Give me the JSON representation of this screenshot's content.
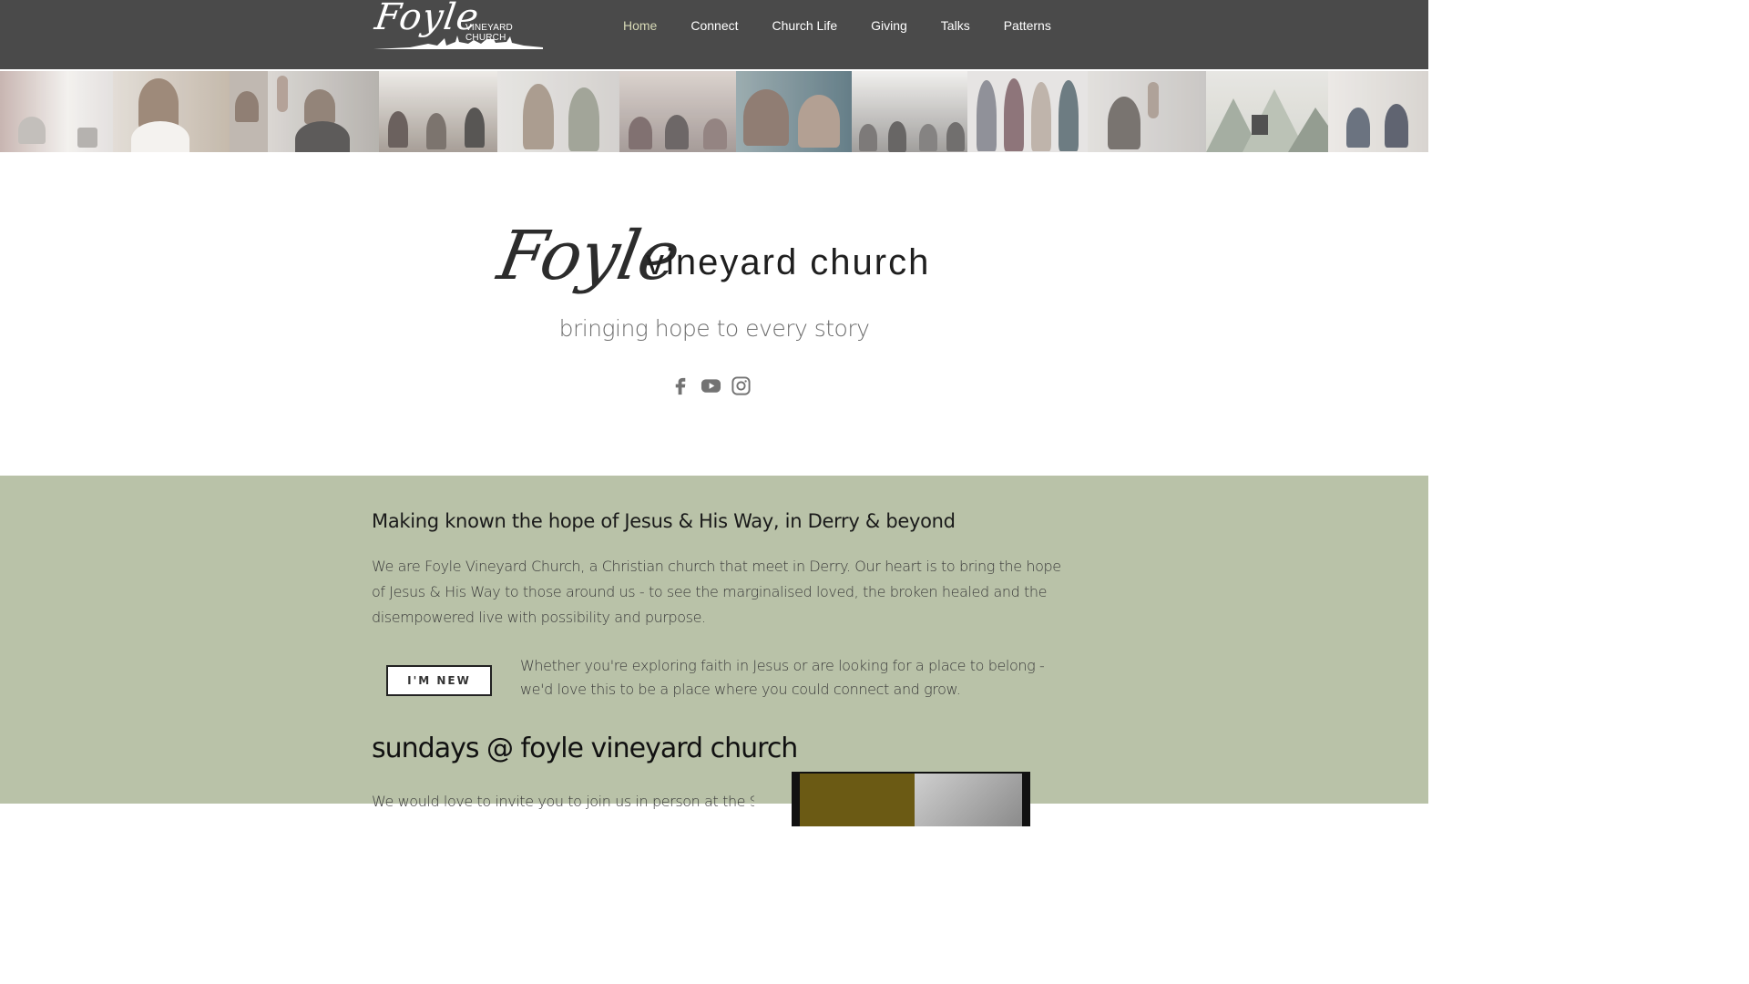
{
  "header": {
    "logo_script": "Foyle",
    "logo_subtitle": "VINEYARD CHURCH",
    "nav": [
      {
        "label": "Home",
        "active": true
      },
      {
        "label": "Connect",
        "active": false
      },
      {
        "label": "Church Life",
        "active": false
      },
      {
        "label": "Giving",
        "active": false
      },
      {
        "label": "Talks",
        "active": false
      },
      {
        "label": "Patterns",
        "active": false
      }
    ]
  },
  "hero": {
    "script": "Foyle",
    "words": "vineyard church",
    "tagline": "bringing hope to every story",
    "social": [
      "facebook-icon",
      "youtube-icon",
      "instagram-icon"
    ]
  },
  "main": {
    "mission_heading": "Making known the hope of Jesus & His Way, in Derry & beyond",
    "intro": "We are Foyle Vineyard Church, a Christian church that meet in Derry. Our heart is to bring the hope of Jesus & His Way to those around us - to see the marginalised loved, the broken healed and the disempowered live with possibility and purpose.",
    "new_button": "I'M NEW",
    "welcome": "Whether you're exploring faith in Jesus or are looking for a place to belong - we'd love this to be a place where you could connect and grow.",
    "sundays_heading": "sundays @ foyle vineyard church",
    "invite_partial": "We would love to invite you to join us in person at the Shit"
  },
  "colors": {
    "header_bg": "#4a4a4a",
    "nav_active": "#d7d9b6",
    "section_green": "#b9c2a8"
  }
}
